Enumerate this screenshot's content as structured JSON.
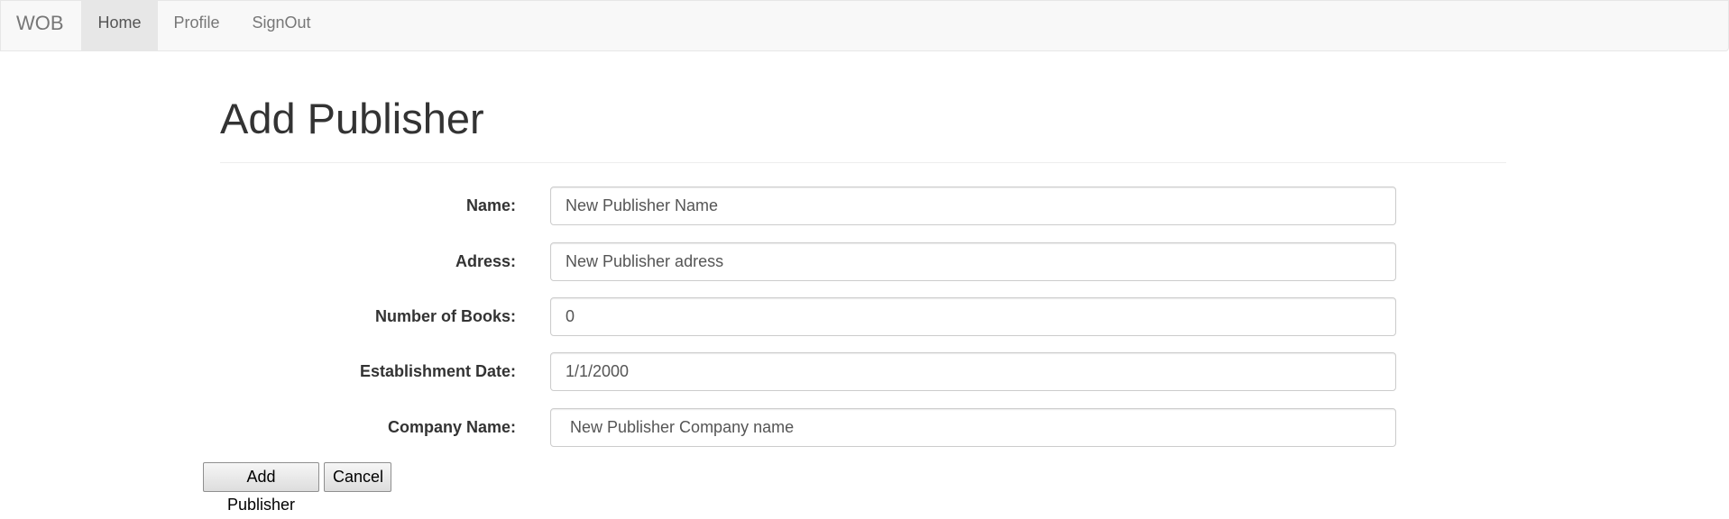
{
  "navbar": {
    "brand": "WOB",
    "items": [
      {
        "label": "Home",
        "active": true
      },
      {
        "label": "Profile",
        "active": false
      },
      {
        "label": "SignOut",
        "active": false
      }
    ]
  },
  "page": {
    "title": "Add Publisher"
  },
  "form": {
    "fields": [
      {
        "label": "Name:",
        "value": "New Publisher Name"
      },
      {
        "label": "Adress:",
        "value": "New Publisher adress"
      },
      {
        "label": "Number of Books:",
        "value": "0"
      },
      {
        "label": "Establishment Date:",
        "value": "1/1/2000"
      },
      {
        "label": "Company Name:",
        "value": " New Publisher Company name"
      }
    ],
    "submit_label": "Add Publisher",
    "cancel_label": "Cancel"
  },
  "colors": {
    "navbar_bg": "#f8f8f8",
    "active_nav_bg": "#e7e7e7",
    "text": "#333333",
    "muted_text": "#777777"
  }
}
